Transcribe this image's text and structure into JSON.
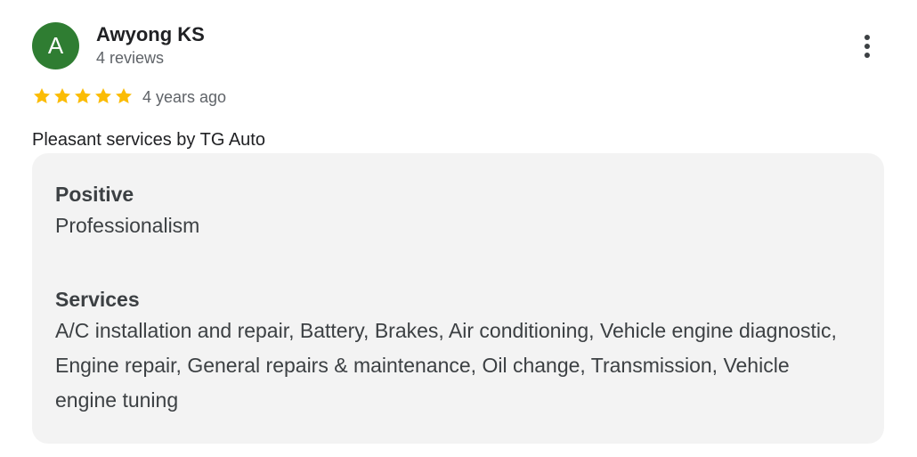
{
  "reviewer": {
    "initial": "A",
    "name": "Awyong KS",
    "reviews": "4 reviews",
    "avatar_color": "#2f7d32"
  },
  "rating": {
    "stars": 5,
    "max": 5,
    "star_color": "#fbbc04",
    "time": "4 years ago"
  },
  "review": {
    "text": "Pleasant services by TG Auto"
  },
  "details": {
    "positive_title": "Positive",
    "positive_value": "Professionalism",
    "services_title": "Services",
    "services_value": "A/C installation and repair, Battery, Brakes, Air conditioning, Vehicle engine diagnostic, Engine repair, General repairs & maintenance, Oil change, Transmission, Vehicle engine tuning"
  },
  "icons": {
    "more": "more-vert-icon",
    "star": "star-icon"
  }
}
